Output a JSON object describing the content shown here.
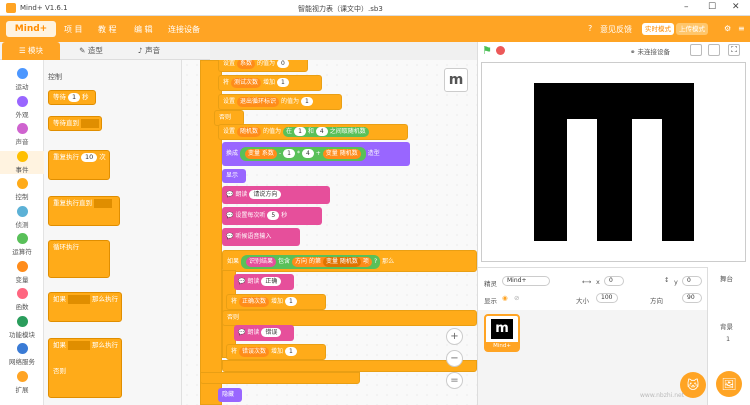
{
  "app": {
    "name": "Mind+ V1.6.1",
    "file_title": "智能视力表（课文中）.sb3",
    "logo_text": "Mind+"
  },
  "menu": {
    "items": [
      "项 目",
      "教 程",
      "编 辑",
      "连接设备"
    ],
    "feedback": "意见反馈",
    "realtime_mode": "实时模式",
    "upload_mode": "上传模式"
  },
  "tabs": {
    "blocks": "模块",
    "costumes": "造型",
    "sounds": "声音"
  },
  "categories": [
    {
      "label": "运动",
      "color": "#4c97ff"
    },
    {
      "label": "外观",
      "color": "#9966ff"
    },
    {
      "label": "声音",
      "color": "#cf63cf"
    },
    {
      "label": "事件",
      "color": "#ffbf00"
    },
    {
      "label": "控制",
      "color": "#ffab19"
    },
    {
      "label": "侦测",
      "color": "#5cb1d6"
    },
    {
      "label": "运算符",
      "color": "#59c059"
    },
    {
      "label": "变量",
      "color": "#ff8c1a"
    },
    {
      "label": "函数",
      "color": "#ff6680"
    },
    {
      "label": "功能模块",
      "color": "#2a9d5c"
    },
    {
      "label": "网络服务",
      "color": "#3a7bd5"
    },
    {
      "label": "扩展",
      "color": "#ffa424"
    }
  ],
  "palette": {
    "heading": "控制",
    "wait": {
      "text": "等待",
      "value": "1",
      "unit": "秒"
    },
    "wait_until": "等待直到",
    "repeat": {
      "text": "重复执行",
      "value": "10",
      "unit": "次"
    },
    "repeat_until": "重复执行直到",
    "forever": "循环执行",
    "if_then": {
      "a": "如果",
      "b": "那么执行"
    },
    "if_then_else": {
      "a": "如果",
      "b": "那么执行",
      "c": "否则"
    }
  },
  "script": {
    "set_coef": {
      "a": "设置",
      "var": "系数",
      "b": "的值为",
      "val": "0"
    },
    "change_test": {
      "a": "将",
      "var": "测试次数",
      "b": "增加",
      "val": "1"
    },
    "set_exit": {
      "a": "设置",
      "var": "退出循环标识",
      "b": "的值为",
      "val": "1"
    },
    "else1": "否则",
    "set_random": {
      "a": "设置",
      "var": "随机数",
      "b": "的值为",
      "c": "在",
      "v1": "1",
      "d": "和",
      "v2": "4",
      "e": "之间取随机数"
    },
    "switch_costume": {
      "a": "换成",
      "var": "变量 系数",
      "op1": "-",
      "v1": "1",
      "op2": "*",
      "v2": "4",
      "op3": "+",
      "var2": "变量 随机数",
      "b": "造型"
    },
    "show": "显示",
    "speak": {
      "a": "朗读",
      "val": "请说方向"
    },
    "set_duration": {
      "a": "设置每次听",
      "val": "5",
      "b": "秒"
    },
    "listen": "听候语音输入",
    "if_contains": {
      "a": "如果",
      "res": "识别结果",
      "b": "包含",
      "list": "方向",
      "c": "的第",
      "var": "变量 随机数",
      "d": "项",
      "e": "?",
      "f": "那么"
    },
    "speak_ok": {
      "a": "朗读",
      "val": "正确"
    },
    "change_correct": {
      "a": "将",
      "var": "正确次数",
      "b": "增加",
      "val": "1"
    },
    "else2": "否则",
    "speak_err": {
      "a": "朗读",
      "val": "错误"
    },
    "change_wrong": {
      "a": "将",
      "var": "错误次数",
      "b": "增加",
      "val": "1"
    },
    "hide": "隐藏"
  },
  "toolbar": {
    "no_device": "未连接设备"
  },
  "sprite": {
    "name_label": "精灵",
    "name": "Mind+",
    "x_label": "x",
    "x": "0",
    "y_label": "y",
    "y": "0",
    "show_label": "显示",
    "size_label": "大小",
    "size": "100",
    "dir_label": "方向",
    "dir": "90",
    "thumb_label": "Mind+"
  },
  "stage_panel": {
    "title": "舞台",
    "bg_label": "背景",
    "bg_count": "1"
  },
  "watermark": "www.nbzhi.net"
}
